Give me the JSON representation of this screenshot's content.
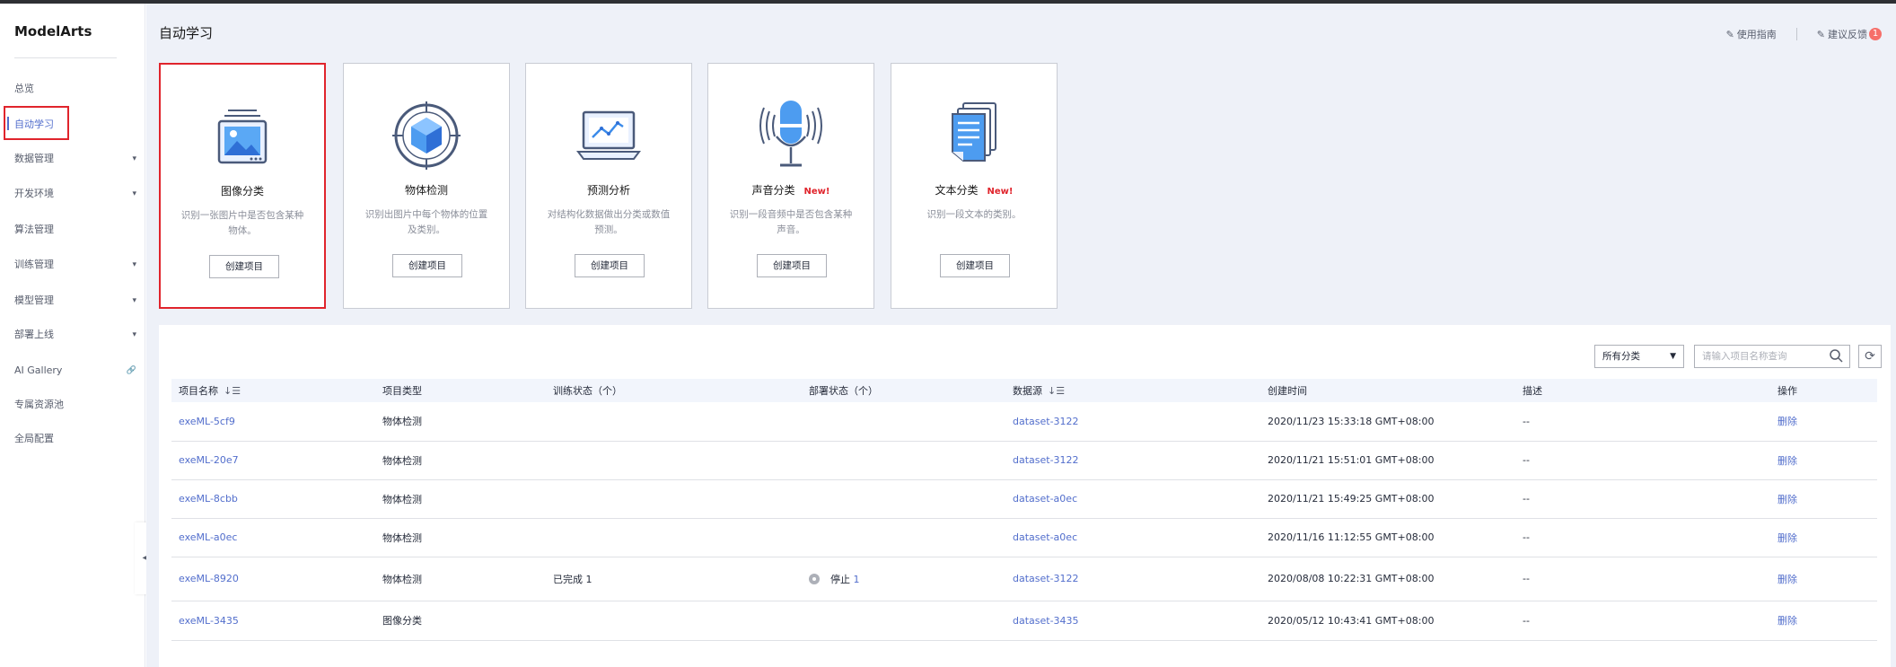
{
  "app": {
    "name": "ModelArts"
  },
  "sidebar": {
    "items": [
      {
        "label": "总览",
        "caret": ""
      },
      {
        "label": "自动学习",
        "caret": ""
      },
      {
        "label": "数据管理",
        "caret": "▾"
      },
      {
        "label": "开发环境",
        "caret": "▾"
      },
      {
        "label": "算法管理",
        "caret": ""
      },
      {
        "label": "训练管理",
        "caret": "▾"
      },
      {
        "label": "模型管理",
        "caret": "▾"
      },
      {
        "label": "部署上线",
        "caret": "▾"
      },
      {
        "label": "AI Gallery",
        "caret": "🔗"
      },
      {
        "label": "专属资源池",
        "caret": ""
      },
      {
        "label": "全局配置",
        "caret": ""
      }
    ],
    "collapse_glyph": "◂"
  },
  "header": {
    "title": "自动学习",
    "guide_icon": "✎",
    "guide_label": "使用指南",
    "feedback_icon": "✎",
    "feedback_label": "建议反馈",
    "feedback_badge": "1"
  },
  "cards": [
    {
      "title": "图像分类",
      "new": "",
      "desc": "识别一张图片中是否包含某种物体。",
      "button": "创建项目",
      "icon": "image-classification-icon"
    },
    {
      "title": "物体检测",
      "new": "",
      "desc": "识别出图片中每个物体的位置及类别。",
      "button": "创建项目",
      "icon": "object-detection-icon"
    },
    {
      "title": "预测分析",
      "new": "",
      "desc": "对结构化数据做出分类或数值预测。",
      "button": "创建项目",
      "icon": "predictive-analysis-icon"
    },
    {
      "title": "声音分类",
      "new": "New!",
      "desc": "识别一段音频中是否包含某种声音。",
      "button": "创建项目",
      "icon": "sound-classification-icon"
    },
    {
      "title": "文本分类",
      "new": "New!",
      "desc": "识别一段文本的类别。",
      "button": "创建项目",
      "icon": "text-classification-icon"
    }
  ],
  "toolbar": {
    "filter_value": "所有分类",
    "search_placeholder": "请输入项目名称查询",
    "refresh_glyph": "⟳"
  },
  "table": {
    "columns": [
      "项目名称",
      "项目类型",
      "训练状态（个）",
      "部署状态（个）",
      "数据源",
      "创建时间",
      "描述",
      "操作"
    ],
    "sort_glyph": "↓☰",
    "rows": [
      {
        "name": "exeML-5cf9",
        "type": "物体检测",
        "train": "",
        "deploy": "",
        "deploy_count": "",
        "source": "dataset-3122",
        "created": "2020/11/23 15:33:18 GMT+08:00",
        "desc": "--",
        "action": "删除"
      },
      {
        "name": "exeML-20e7",
        "type": "物体检测",
        "train": "",
        "deploy": "",
        "deploy_count": "",
        "source": "dataset-3122",
        "created": "2020/11/21 15:51:01 GMT+08:00",
        "desc": "--",
        "action": "删除"
      },
      {
        "name": "exeML-8cbb",
        "type": "物体检测",
        "train": "",
        "deploy": "",
        "deploy_count": "",
        "source": "dataset-a0ec",
        "created": "2020/11/21 15:49:25 GMT+08:00",
        "desc": "--",
        "action": "删除"
      },
      {
        "name": "exeML-a0ec",
        "type": "物体检测",
        "train": "",
        "deploy": "",
        "deploy_count": "",
        "source": "dataset-a0ec",
        "created": "2020/11/16 11:12:55 GMT+08:00",
        "desc": "--",
        "action": "删除"
      },
      {
        "name": "exeML-8920",
        "type": "物体检测",
        "train": "已完成 1",
        "deploy": "停止",
        "deploy_count": "1",
        "source": "dataset-3122",
        "created": "2020/08/08 10:22:31 GMT+08:00",
        "desc": "--",
        "action": "删除"
      },
      {
        "name": "exeML-3435",
        "type": "图像分类",
        "train": "",
        "deploy": "",
        "deploy_count": "",
        "source": "dataset-3435",
        "created": "2020/05/12 10:43:41 GMT+08:00",
        "desc": "--",
        "action": "删除"
      }
    ]
  },
  "colors": {
    "accent": "#526ecc",
    "highlight": "#e0242c",
    "page_bg": "#eef1f8"
  }
}
